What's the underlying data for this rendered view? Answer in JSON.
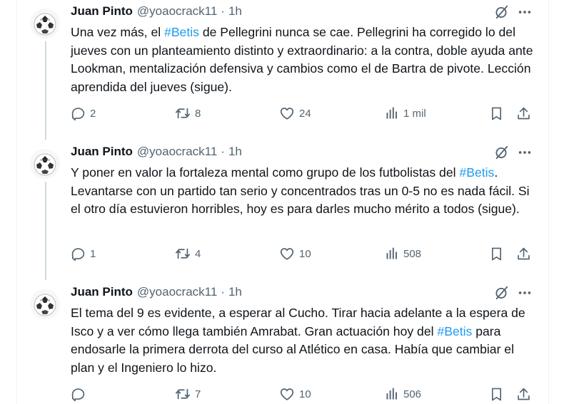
{
  "tweets": [
    {
      "author": {
        "name": "Juan Pinto",
        "handle": "@yoaocrack11",
        "time": "1h",
        "separator": "·"
      },
      "body": [
        {
          "text": "Una vez más, el "
        },
        {
          "text": "#Betis",
          "hashtag": true
        },
        {
          "text": " de Pellegrini nunca se cae. Pellegrini ha corregido lo del jueves con un planteamiento distinto y extraordinario: a la contra, doble ayuda ante Lookman, mentalización defensiva y cambios como el de Bartra de pivote. Lección aprendida del jueves (sigue)."
        }
      ],
      "stats": {
        "replies": "2",
        "reposts": "8",
        "likes": "24",
        "views": "1 mil"
      }
    },
    {
      "author": {
        "name": "Juan Pinto",
        "handle": "@yoaocrack11",
        "time": "1h",
        "separator": "·"
      },
      "body": [
        {
          "text": "Y poner en valor la fortaleza mental como grupo de los futbolistas del "
        },
        {
          "text": "#Betis",
          "hashtag": true
        },
        {
          "text": ". Levantarse con un partido tan serio y concentrados tras un 0-5 no es nada fácil. Si el otro día estuvieron horribles, hoy es para darles mucho mérito a todos (sigue)."
        }
      ],
      "stats": {
        "replies": "1",
        "reposts": "4",
        "likes": "10",
        "views": "508"
      }
    },
    {
      "author": {
        "name": "Juan Pinto",
        "handle": "@yoaocrack11",
        "time": "1h",
        "separator": "·"
      },
      "body": [
        {
          "text": "El tema del 9 es evidente, a esperar al Cucho. Tirar hacia adelante a la espera de Isco y a ver cómo llega también Amrabat. Gran actuación hoy del "
        },
        {
          "text": "#Betis",
          "hashtag": true
        },
        {
          "text": " para endosarle la primera derrota del curso al Atlético en casa. Había que cambiar el plan y el Ingeniero lo hizo."
        }
      ],
      "stats": {
        "replies": "",
        "reposts": "7",
        "likes": "10",
        "views": "506"
      }
    }
  ],
  "icons": {
    "grok": "grok-icon",
    "more": "more-icon",
    "reply": "reply-icon",
    "repost": "repost-icon",
    "like": "like-icon",
    "views": "views-icon",
    "bookmark": "bookmark-icon",
    "share": "share-icon"
  },
  "colors": {
    "text": "#0f1419",
    "secondary": "#536471",
    "hashtag": "#1d9bf0",
    "thread_line": "#cfd9de"
  }
}
